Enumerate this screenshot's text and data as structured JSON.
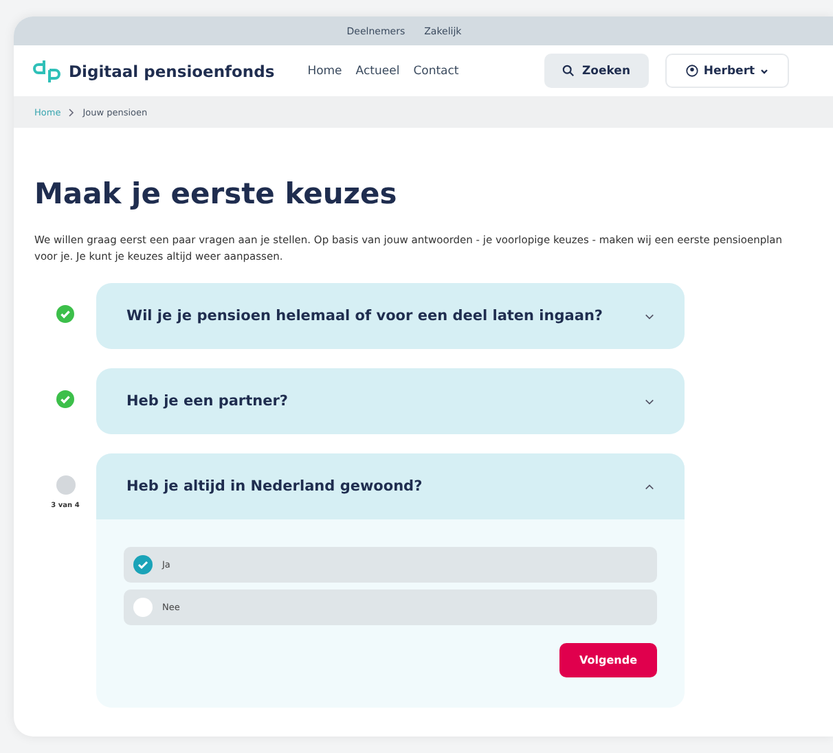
{
  "top_links": [
    "Deelnemers",
    "Zakelijk"
  ],
  "brand": "Digitaal pensioenfonds",
  "nav": [
    "Home",
    "Actueel",
    "Contact"
  ],
  "search_button": "Zoeken",
  "user_button": "Herbert",
  "breadcrumb": [
    "Home",
    "Jouw pensioen"
  ],
  "title": "Maak je eerste keuzes",
  "intro": "We willen graag eerst een paar vragen aan je stellen. Op basis van jouw antwoorden - je voorlopige keuzes - maken wij een eerste pensioenplan voor je. Je kunt je keuzes altijd weer aanpassen.",
  "steps": [
    {
      "question": "Wil je je pensioen helemaal of voor een deel laten ingaan?",
      "completed": true,
      "expanded": false
    },
    {
      "question": "Heb je een partner?",
      "completed": true,
      "expanded": false
    },
    {
      "question": "Heb je altijd in Nederland gewoond?",
      "completed": false,
      "step_label": "3 van 4",
      "expanded": true,
      "options": [
        {
          "label": "Ja",
          "selected": true
        },
        {
          "label": "Nee",
          "selected": false
        }
      ],
      "next_button": "Volgende"
    }
  ]
}
